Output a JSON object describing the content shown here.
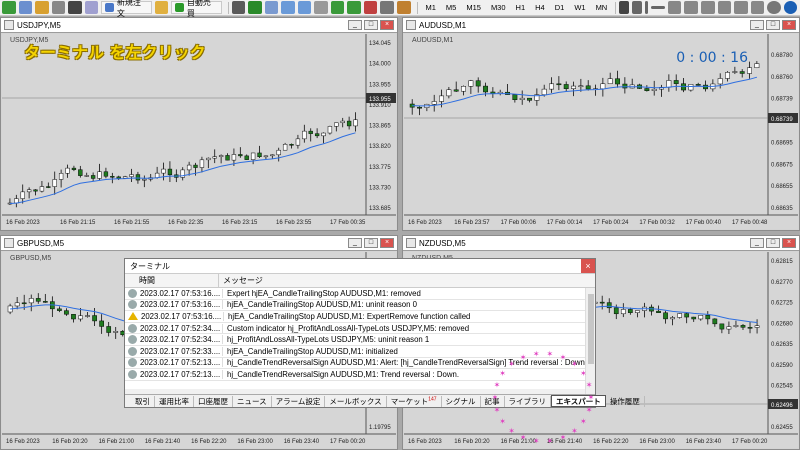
{
  "toolbar": {
    "new_order_label": "新規注文",
    "auto_trade_label": "自動売買",
    "timeframes": [
      "M1",
      "M5",
      "M15",
      "M30",
      "H1",
      "H4",
      "D1",
      "W1",
      "MN"
    ]
  },
  "windows": {
    "usdjpy": {
      "title": "USDJPY,M5",
      "symbol_label": "USDJPY,M5",
      "prices": [
        "134.045",
        "134.000",
        "133.955",
        "133.910",
        "133.865",
        "133.820",
        "133.775",
        "133.730",
        "133.685"
      ],
      "current_price": "133.955",
      "times": [
        "16 Feb 2023",
        "16 Feb 21:15",
        "16 Feb 21:55",
        "16 Feb 22:35",
        "16 Feb 23:15",
        "16 Feb 23:55",
        "17 Feb 00:35"
      ]
    },
    "audusd": {
      "title": "AUDUSD,M1",
      "symbol_label": "AUDUSD,M1",
      "clock": "0 : 00 : 16",
      "prices": [
        "0.68780",
        "0.68760",
        "0.68739",
        "0.68720",
        "0.68695",
        "0.68675",
        "0.68655",
        "0.68635"
      ],
      "current_price": "0.68739",
      "times": [
        "16 Feb 2023",
        "16 Feb 23:57",
        "17 Feb 00:06",
        "17 Feb 00:14",
        "17 Feb 00:24",
        "17 Feb 00:32",
        "17 Feb 00:40",
        "17 Feb 00:48"
      ]
    },
    "gbpusd": {
      "title": "GBPUSD,M5",
      "symbol_label": "GBPUSD,M5",
      "prices": [
        "1.19841",
        "1.19795"
      ],
      "times": [
        "16 Feb 2023",
        "16 Feb 20:20",
        "16 Feb 21:00",
        "16 Feb 21:40",
        "16 Feb 22:20",
        "16 Feb 23:00",
        "16 Feb 23:40",
        "17 Feb 00:20"
      ]
    },
    "nzdusd": {
      "title": "NZDUSD,M5",
      "symbol_label": "NZDUSD,M5",
      "prices": [
        "0.62815",
        "0.62770",
        "0.62725",
        "0.62680",
        "0.62635",
        "0.62590",
        "0.62545",
        "0.62496",
        "0.62455"
      ],
      "current_price": "0.62496",
      "times": [
        "16 Feb 2023",
        "16 Feb 20:20",
        "16 Feb 21:00",
        "16 Feb 21:40",
        "16 Feb 22:20",
        "16 Feb 23:00",
        "16 Feb 23:40",
        "17 Feb 00:20"
      ]
    }
  },
  "overlay_text": "ターミナル を左クリック",
  "terminal": {
    "title": "ターミナル",
    "col_time": "時間",
    "col_message": "メッセージ",
    "rows": [
      {
        "time": "2023.02.17 07:53:16....",
        "msg": "Expert hjEA_CandleTrailingStop AUDUSD,M1: removed",
        "warn": false
      },
      {
        "time": "2023.02.17 07:53:16....",
        "msg": "hjEA_CandleTrailingStop AUDUSD,M1: uninit reason 0",
        "warn": false
      },
      {
        "time": "2023.02.17 07:53:16....",
        "msg": "hjEA_CandleTrailingStop AUDUSD,M1: ExpertRemove function called",
        "warn": true
      },
      {
        "time": "2023.02.17 07:52:34....",
        "msg": "Custom indicator hj_ProfitAndLossAll-TypeLots USDJPY,M5: removed",
        "warn": false
      },
      {
        "time": "2023.02.17 07:52:34....",
        "msg": "hj_ProfitAndLossAll-TypeLots USDJPY,M5: uninit reason 1",
        "warn": false
      },
      {
        "time": "2023.02.17 07:52:33....",
        "msg": "hjEA_CandleTrailingStop AUDUSD,M1: initialized",
        "warn": false
      },
      {
        "time": "2023.02.17 07:52:13....",
        "msg": "hj_CandleTrendReversalSign AUDUSD,M1: Alert: [hj_CandleTrendReversalSign] Trend reversal : Down.¥n¥nPAI...",
        "warn": false
      },
      {
        "time": "2023.02.17 07:52:13....",
        "msg": "hj_CandleTrendReversalSign AUDUSD,M1: Trend reversal : Down.",
        "warn": false
      }
    ],
    "tabs": [
      "取引",
      "運用比率",
      "口座履歴",
      "ニュース",
      "アラーム設定",
      "メールボックス",
      "マーケット",
      "シグナル",
      "記事",
      "ライブラリ",
      "エキスパート",
      "操作履歴"
    ],
    "market_badge": "147",
    "active_tab": "エキスパート"
  },
  "colors": {
    "bull": "#ffffff",
    "bear": "#1e7a1e",
    "candle_up": "#00b400",
    "ma": "#2f6fe0",
    "price_tag": "#333333",
    "overlay": "#f5d400",
    "highlight": "#e040c0"
  }
}
